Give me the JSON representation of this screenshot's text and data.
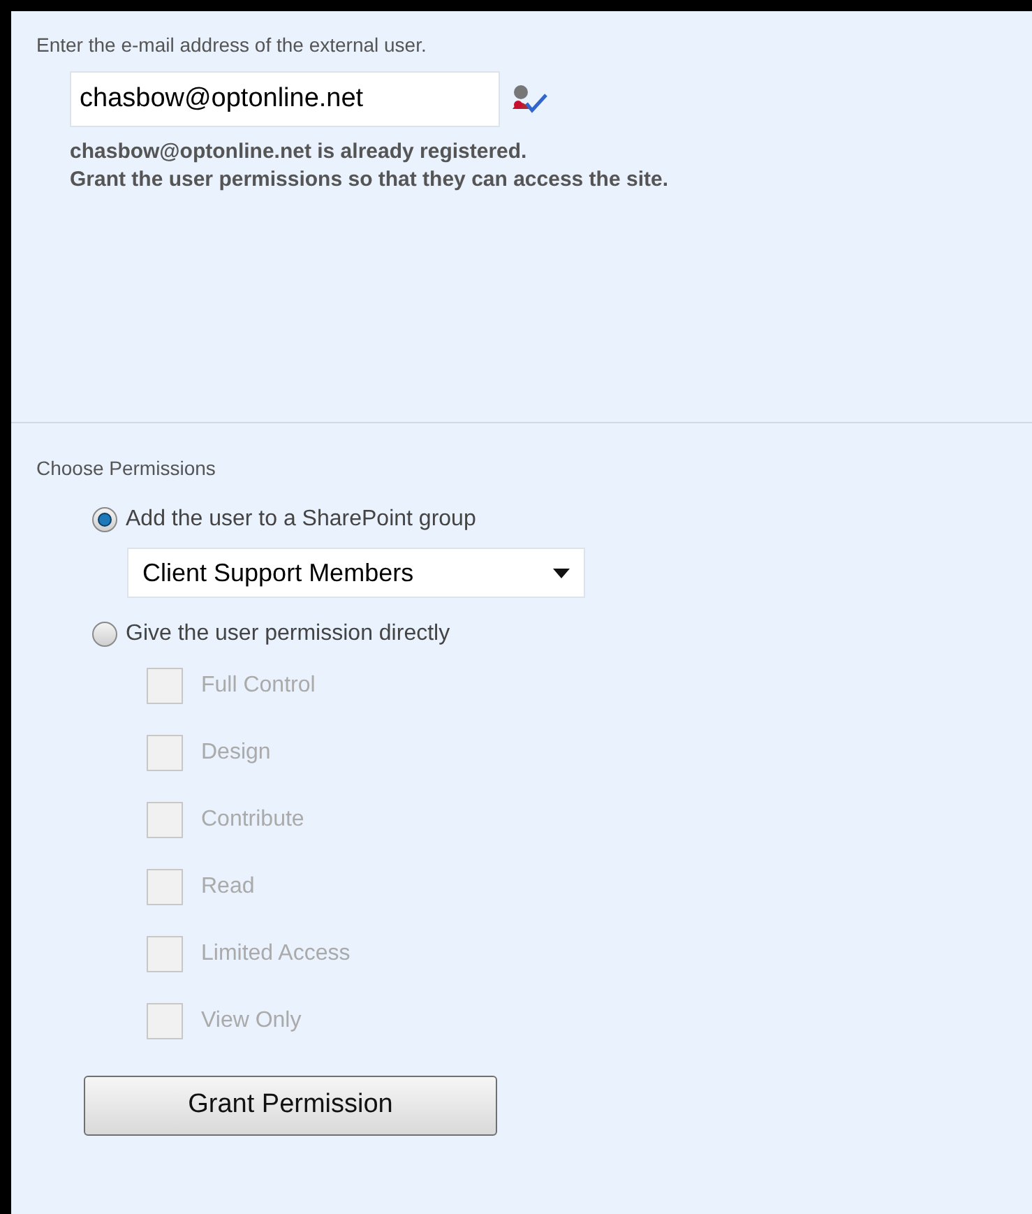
{
  "email_section": {
    "label": "Enter the e-mail address of the external user.",
    "email_value": "chasbow@optonline.net",
    "message_lines": [
      "chasbow@optonline.net is already registered.",
      "Grant the user permissions so that they can access the site."
    ]
  },
  "permissions": {
    "title": "Choose Permissions",
    "options": [
      {
        "kind": "group",
        "label": "Add the user to a SharePoint group",
        "selected": true,
        "dropdown_value": "Client Support Members"
      },
      {
        "kind": "direct",
        "label": "Give the user permission directly",
        "selected": false,
        "permissions": [
          {
            "label": "Full Control",
            "checked": false,
            "disabled": true
          },
          {
            "label": "Design",
            "checked": false,
            "disabled": true
          },
          {
            "label": "Contribute",
            "checked": false,
            "disabled": true
          },
          {
            "label": "Read",
            "checked": false,
            "disabled": true
          },
          {
            "label": "Limited Access",
            "checked": false,
            "disabled": true
          },
          {
            "label": "View Only",
            "checked": false,
            "disabled": true
          }
        ]
      }
    ]
  },
  "button": "Grant Permission"
}
